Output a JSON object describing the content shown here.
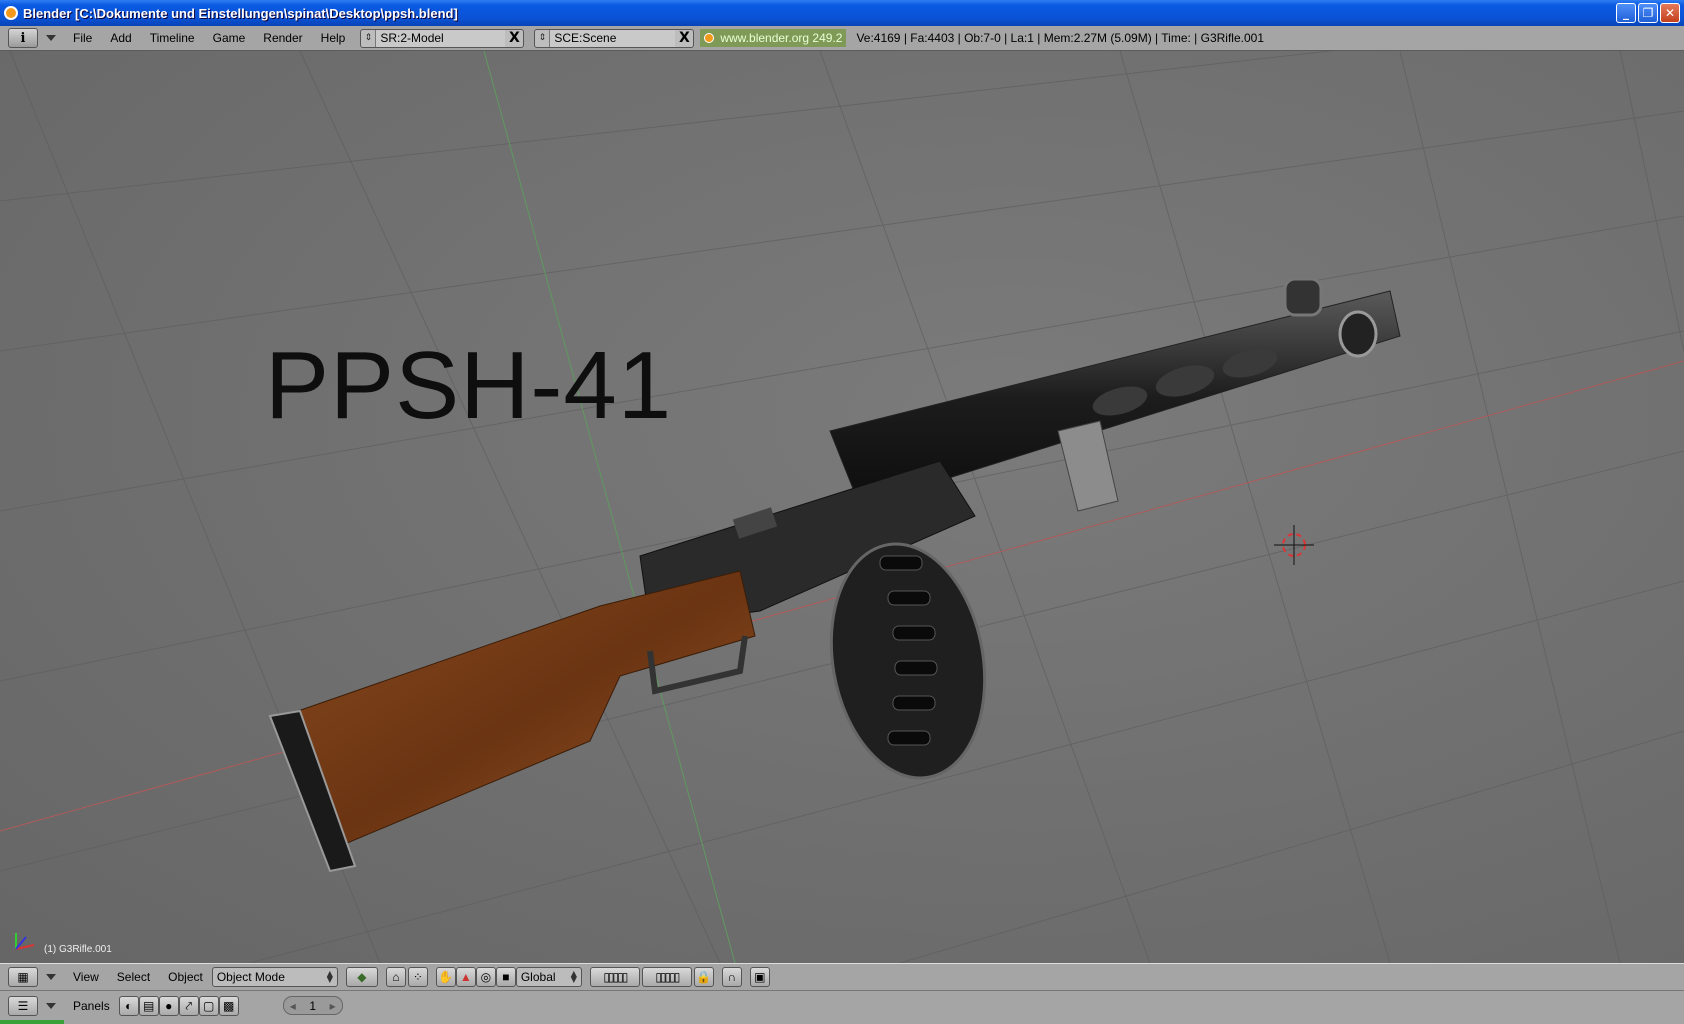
{
  "window": {
    "title": "Blender [C:\\Dokumente und Einstellungen\\spinat\\Desktop\\ppsh.blend]",
    "minimize_glyph": "_",
    "maximize_glyph": "❐",
    "close_glyph": "✕"
  },
  "info_header": {
    "window_type_glyph": "i",
    "menus": [
      "File",
      "Add",
      "Timeline",
      "Game",
      "Render",
      "Help"
    ],
    "screen_browse": "SR:2-Model",
    "scene_browse": "SCE:Scene",
    "delete_glyph": "X",
    "url": "www.blender.org 249.2",
    "stats": "Ve:4169 | Fa:4403 | Ob:7-0 | La:1   | Mem:2.27M (5.09M)   | Time: | G3Rifle.001"
  },
  "viewport": {
    "overlay_text": "PPSH-41",
    "object_label": "(1) G3Rifle.001"
  },
  "view3d_header": {
    "menus": [
      "View",
      "Select",
      "Object"
    ],
    "mode": "Object Mode",
    "transform_orientation": "Global"
  },
  "buttons_header": {
    "label": "Panels",
    "frame": "1"
  },
  "colors": {
    "titlebar": "#0a52d6",
    "header_gray": "#a5a5a5",
    "viewport_gray": "#6f6f6f",
    "url_green": "#7f9a57"
  }
}
